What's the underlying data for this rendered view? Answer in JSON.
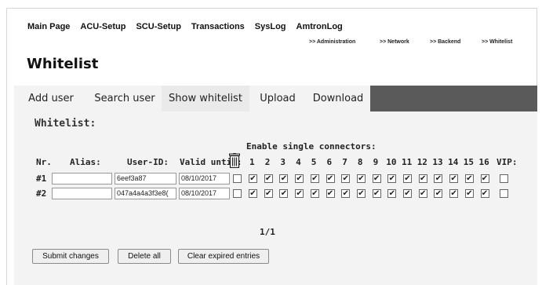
{
  "topnav": [
    "Main Page",
    "ACU-Setup",
    "SCU-Setup",
    "Transactions",
    "SysLog",
    "AmtronLog"
  ],
  "subnav": [
    ">> Administration",
    ">> Network",
    ">> Backend",
    ">> Whitelist"
  ],
  "page_title": "Whitelist",
  "tabs": [
    "Add user",
    "Search user",
    "Show whitelist",
    "Upload",
    "Download"
  ],
  "active_tab": "Show whitelist",
  "section_title": "Whitelist:",
  "enable_connectors_label": "Enable single connectors:",
  "columns": {
    "nr": "Nr.",
    "alias": "Alias:",
    "user_id": "User-ID:",
    "valid_until": "Valid until:",
    "delete_icon": "trash-icon",
    "connectors": [
      "1",
      "2",
      "3",
      "4",
      "5",
      "6",
      "7",
      "8",
      "9",
      "10",
      "11",
      "12",
      "13",
      "14",
      "15",
      "16"
    ],
    "vip": "VIP:"
  },
  "rows": [
    {
      "nr": "#1",
      "alias": "",
      "user_id": "6eef3a87",
      "valid_until": "08/10/2017",
      "delete": false,
      "connectors_checked": [
        true,
        true,
        true,
        true,
        true,
        true,
        true,
        true,
        true,
        true,
        true,
        true,
        true,
        true,
        true,
        true
      ],
      "vip": false
    },
    {
      "nr": "#2",
      "alias": "",
      "user_id": "047a4a4a3f3e8(",
      "valid_until": "08/10/2017",
      "delete": false,
      "connectors_checked": [
        true,
        true,
        true,
        true,
        true,
        true,
        true,
        true,
        true,
        true,
        true,
        true,
        true,
        true,
        true,
        true
      ],
      "vip": false
    }
  ],
  "pagination": "1/1",
  "buttons": {
    "submit": "Submit changes",
    "delete_all": "Delete all",
    "clear_expired": "Clear expired entries"
  }
}
